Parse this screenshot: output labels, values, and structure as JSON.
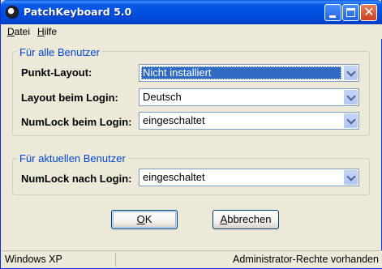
{
  "window": {
    "title": "PatchKeyboard 5.0",
    "icon": "yin-yang-icon"
  },
  "menu": {
    "datei_first": "D",
    "datei_rest": "atei",
    "hilfe_first": "H",
    "hilfe_rest": "ilfe"
  },
  "groups": {
    "all_users": {
      "title": "Für alle Benutzer",
      "rows": [
        {
          "label": "Punkt-Layout:",
          "value": "Nicht installiert",
          "selected": true
        },
        {
          "label": "Layout beim Login:",
          "value": "Deutsch"
        },
        {
          "label": "NumLock beim Login:",
          "value": "eingeschaltet"
        }
      ]
    },
    "current_user": {
      "title": "Für aktuellen Benutzer",
      "rows": [
        {
          "label": "NumLock nach Login:",
          "value": "eingeschaltet"
        }
      ]
    }
  },
  "buttons": {
    "ok_first": "O",
    "ok_rest": "K",
    "cancel_first": "A",
    "cancel_rest": "bbrechen"
  },
  "status": {
    "os": "Windows XP",
    "rights": "Administrator-Rechte vorhanden"
  },
  "colors": {
    "titlebar": "#0050e0",
    "group_title": "#0046d5",
    "selection": "#316ac5",
    "window_bg": "#ece9d8"
  }
}
